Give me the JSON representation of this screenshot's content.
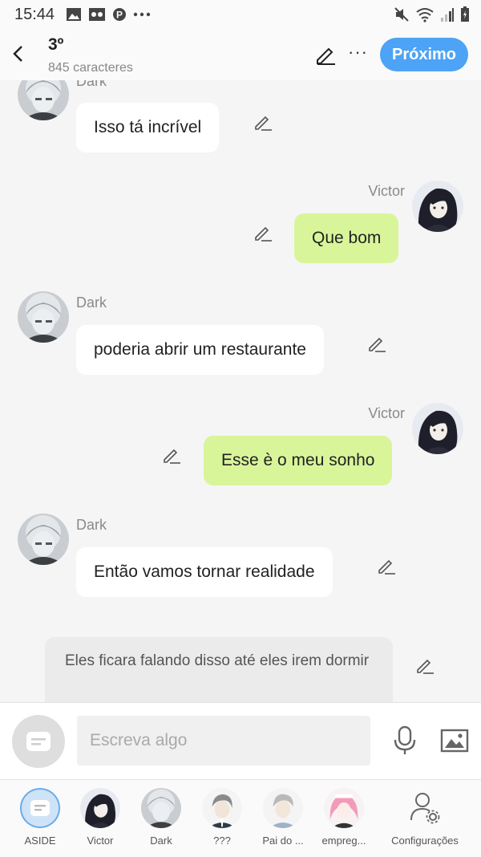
{
  "status_bar": {
    "time": "15:44",
    "left_icons": [
      "image-icon",
      "voicemail-icon",
      "pinterest-icon",
      "more-dots-icon"
    ],
    "right_icons": [
      "mute-icon",
      "wifi-icon",
      "signal-icon",
      "battery-icon"
    ]
  },
  "header": {
    "title": "3º",
    "subtitle": "845 caracteres",
    "next_label": "Próximo"
  },
  "messages": [
    {
      "sender": "Dark",
      "text": "Isso tá incrível",
      "side": "left"
    },
    {
      "sender": "Victor",
      "text": "Que bom",
      "side": "right"
    },
    {
      "sender": "Dark",
      "text": "poderia abrir um restaurante",
      "side": "left"
    },
    {
      "sender": "Victor",
      "text": "Esse è o meu sonho",
      "side": "right"
    },
    {
      "sender": "Dark",
      "text": "Então vamos tornar realidade",
      "side": "left"
    }
  ],
  "narration": {
    "text": "Eles ficara falando disso até eles irem dormir"
  },
  "composer": {
    "placeholder": "Escreva algo"
  },
  "bottom_nav": [
    {
      "label": "ASIDE"
    },
    {
      "label": "Victor"
    },
    {
      "label": "Dark"
    },
    {
      "label": "???"
    },
    {
      "label": "Pai do ..."
    },
    {
      "label": "empreg..."
    },
    {
      "label": "Configurações"
    }
  ],
  "colors": {
    "accent": "#4da3f5",
    "right_bubble": "#d9f59a",
    "left_bubble": "#ffffff",
    "background": "#f5f5f5"
  }
}
